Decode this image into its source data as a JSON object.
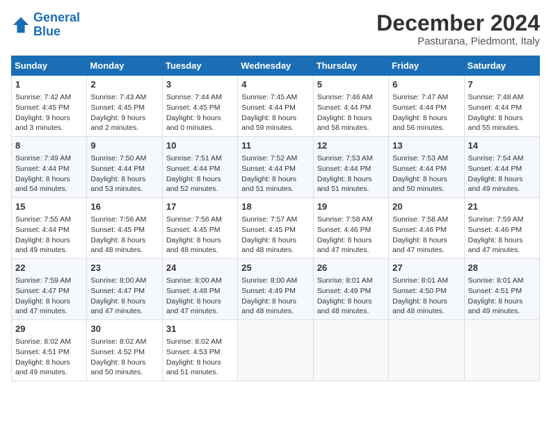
{
  "header": {
    "logo_general": "General",
    "logo_blue": "Blue",
    "title": "December 2024",
    "subtitle": "Pasturana, Piedmont, Italy"
  },
  "weekdays": [
    "Sunday",
    "Monday",
    "Tuesday",
    "Wednesday",
    "Thursday",
    "Friday",
    "Saturday"
  ],
  "weeks": [
    [
      {
        "day": "1",
        "sunrise": "7:42 AM",
        "sunset": "4:45 PM",
        "daylight": "9 hours and 3 minutes."
      },
      {
        "day": "2",
        "sunrise": "7:43 AM",
        "sunset": "4:45 PM",
        "daylight": "9 hours and 2 minutes."
      },
      {
        "day": "3",
        "sunrise": "7:44 AM",
        "sunset": "4:45 PM",
        "daylight": "9 hours and 0 minutes."
      },
      {
        "day": "4",
        "sunrise": "7:45 AM",
        "sunset": "4:44 PM",
        "daylight": "8 hours and 59 minutes."
      },
      {
        "day": "5",
        "sunrise": "7:46 AM",
        "sunset": "4:44 PM",
        "daylight": "8 hours and 58 minutes."
      },
      {
        "day": "6",
        "sunrise": "7:47 AM",
        "sunset": "4:44 PM",
        "daylight": "8 hours and 56 minutes."
      },
      {
        "day": "7",
        "sunrise": "7:48 AM",
        "sunset": "4:44 PM",
        "daylight": "8 hours and 55 minutes."
      }
    ],
    [
      {
        "day": "8",
        "sunrise": "7:49 AM",
        "sunset": "4:44 PM",
        "daylight": "8 hours and 54 minutes."
      },
      {
        "day": "9",
        "sunrise": "7:50 AM",
        "sunset": "4:44 PM",
        "daylight": "8 hours and 53 minutes."
      },
      {
        "day": "10",
        "sunrise": "7:51 AM",
        "sunset": "4:44 PM",
        "daylight": "8 hours and 52 minutes."
      },
      {
        "day": "11",
        "sunrise": "7:52 AM",
        "sunset": "4:44 PM",
        "daylight": "8 hours and 51 minutes."
      },
      {
        "day": "12",
        "sunrise": "7:53 AM",
        "sunset": "4:44 PM",
        "daylight": "8 hours and 51 minutes."
      },
      {
        "day": "13",
        "sunrise": "7:53 AM",
        "sunset": "4:44 PM",
        "daylight": "8 hours and 50 minutes."
      },
      {
        "day": "14",
        "sunrise": "7:54 AM",
        "sunset": "4:44 PM",
        "daylight": "8 hours and 49 minutes."
      }
    ],
    [
      {
        "day": "15",
        "sunrise": "7:55 AM",
        "sunset": "4:44 PM",
        "daylight": "8 hours and 49 minutes."
      },
      {
        "day": "16",
        "sunrise": "7:56 AM",
        "sunset": "4:45 PM",
        "daylight": "8 hours and 48 minutes."
      },
      {
        "day": "17",
        "sunrise": "7:56 AM",
        "sunset": "4:45 PM",
        "daylight": "8 hours and 48 minutes."
      },
      {
        "day": "18",
        "sunrise": "7:57 AM",
        "sunset": "4:45 PM",
        "daylight": "8 hours and 48 minutes."
      },
      {
        "day": "19",
        "sunrise": "7:58 AM",
        "sunset": "4:46 PM",
        "daylight": "8 hours and 47 minutes."
      },
      {
        "day": "20",
        "sunrise": "7:58 AM",
        "sunset": "4:46 PM",
        "daylight": "8 hours and 47 minutes."
      },
      {
        "day": "21",
        "sunrise": "7:59 AM",
        "sunset": "4:46 PM",
        "daylight": "8 hours and 47 minutes."
      }
    ],
    [
      {
        "day": "22",
        "sunrise": "7:59 AM",
        "sunset": "4:47 PM",
        "daylight": "8 hours and 47 minutes."
      },
      {
        "day": "23",
        "sunrise": "8:00 AM",
        "sunset": "4:47 PM",
        "daylight": "8 hours and 47 minutes."
      },
      {
        "day": "24",
        "sunrise": "8:00 AM",
        "sunset": "4:48 PM",
        "daylight": "8 hours and 47 minutes."
      },
      {
        "day": "25",
        "sunrise": "8:00 AM",
        "sunset": "4:49 PM",
        "daylight": "8 hours and 48 minutes."
      },
      {
        "day": "26",
        "sunrise": "8:01 AM",
        "sunset": "4:49 PM",
        "daylight": "8 hours and 48 minutes."
      },
      {
        "day": "27",
        "sunrise": "8:01 AM",
        "sunset": "4:50 PM",
        "daylight": "8 hours and 48 minutes."
      },
      {
        "day": "28",
        "sunrise": "8:01 AM",
        "sunset": "4:51 PM",
        "daylight": "8 hours and 49 minutes."
      }
    ],
    [
      {
        "day": "29",
        "sunrise": "8:02 AM",
        "sunset": "4:51 PM",
        "daylight": "8 hours and 49 minutes."
      },
      {
        "day": "30",
        "sunrise": "8:02 AM",
        "sunset": "4:52 PM",
        "daylight": "8 hours and 50 minutes."
      },
      {
        "day": "31",
        "sunrise": "8:02 AM",
        "sunset": "4:53 PM",
        "daylight": "8 hours and 51 minutes."
      },
      null,
      null,
      null,
      null
    ]
  ]
}
